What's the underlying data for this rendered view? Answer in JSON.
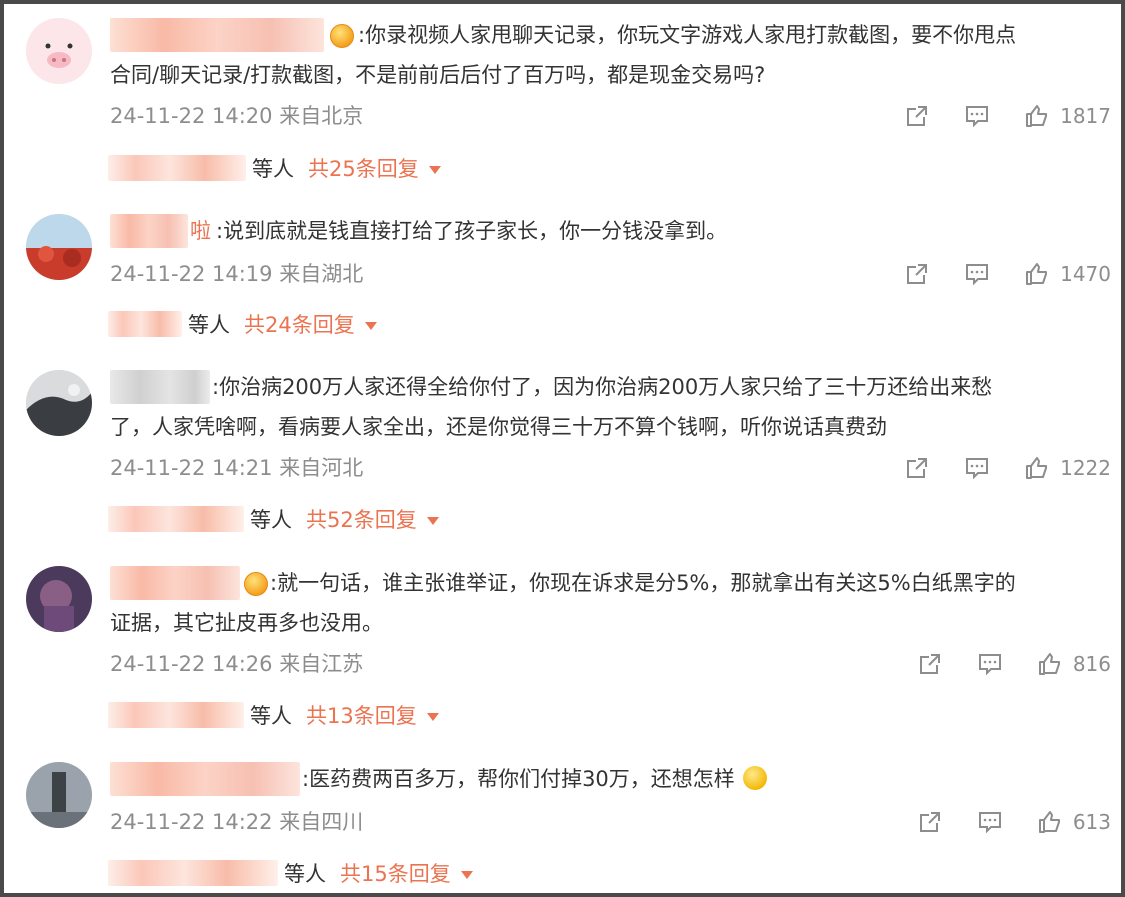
{
  "colors": {
    "accent": "#eb7350",
    "meta": "#8d8d8d",
    "text": "#333333"
  },
  "icons": [
    "share-icon",
    "comment-icon",
    "like-icon",
    "caret-down-icon"
  ],
  "comments": [
    {
      "name_tail": "",
      "text_lines": [
        ":你录视频人家甩聊天记录，你玩文字游戏人家甩打款截图，要不你甩点",
        "合同/聊天记录/打款截图，不是前前后后付了百万吗，都是现金交易吗?"
      ],
      "time": "24-11-22 14:20",
      "location": "来自北京",
      "likes": "1817",
      "reply_suffix": "等人",
      "reply_count": "共25条回复"
    },
    {
      "name_tail": "啦",
      "text_lines": [
        ":说到底就是钱直接打给了孩子家长，你一分钱没拿到。"
      ],
      "time": "24-11-22 14:19",
      "location": "来自湖北",
      "likes": "1470",
      "reply_suffix": "等人",
      "reply_count": "共24条回复"
    },
    {
      "name_tail": "",
      "text_lines": [
        ":你治病200万人家还得全给你付了，因为你治病200万人家只给了三十万还给出来愁",
        "了，人家凭啥啊，看病要人家全出，还是你觉得三十万不算个钱啊，听你说话真费劲"
      ],
      "time": "24-11-22 14:21",
      "location": "来自河北",
      "likes": "1222",
      "reply_suffix": "等人",
      "reply_count": "共52条回复"
    },
    {
      "name_tail": "",
      "text_lines": [
        ":就一句话，谁主张谁举证，你现在诉求是分5%，那就拿出有关这5%白纸黑字的",
        "证据，其它扯皮再多也没用。"
      ],
      "time": "24-11-22 14:26",
      "location": "来自江苏",
      "likes": "816",
      "reply_suffix": "等人",
      "reply_count": "共13条回复"
    },
    {
      "name_tail": "",
      "text_lines": [
        ":医药费两百多万，帮你们付掉30万，还想怎样"
      ],
      "time": "24-11-22 14:22",
      "location": "来自四川",
      "likes": "613",
      "reply_suffix": "等人",
      "reply_count": "共15条回复"
    }
  ]
}
